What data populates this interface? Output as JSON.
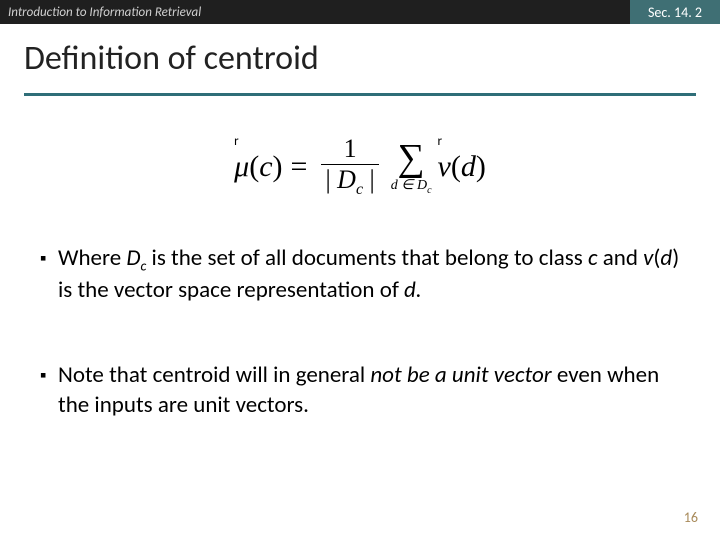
{
  "header": {
    "left": "Introduction to Information Retrieval",
    "right": "Sec. 14. 2"
  },
  "title": "Definition of centroid",
  "formula": {
    "arrow_label": "r",
    "mu": "μ",
    "mu_arg_open": "(",
    "mu_arg_var": "c",
    "mu_arg_close": ")",
    "equals": "=",
    "frac_num": "1",
    "frac_den_open": "| ",
    "frac_den_D": "D",
    "frac_den_sub": "c",
    "frac_den_close": " |",
    "sigma": "∑",
    "sum_lower": "d ∈ D",
    "sum_lower_sub": "c",
    "v": "v",
    "v_arg_open": "(",
    "v_arg_var": "d",
    "v_arg_close": ")"
  },
  "bullets": [
    {
      "pre": "Where ",
      "t1": "D",
      "t1sub": "c",
      "mid1": " is the set of all documents that belong to class ",
      "t2": "c",
      "mid2": " and ",
      "t3": "v",
      "t3a": "(",
      "t3b": "d",
      "t3c": ")",
      "mid3": " is the vector space representation of ",
      "t4": "d.",
      "post": ""
    },
    {
      "pre": "Note that centroid will in general ",
      "em": "not be a unit vector",
      "post": " even when the inputs are unit vectors."
    }
  ],
  "page_number": "16"
}
